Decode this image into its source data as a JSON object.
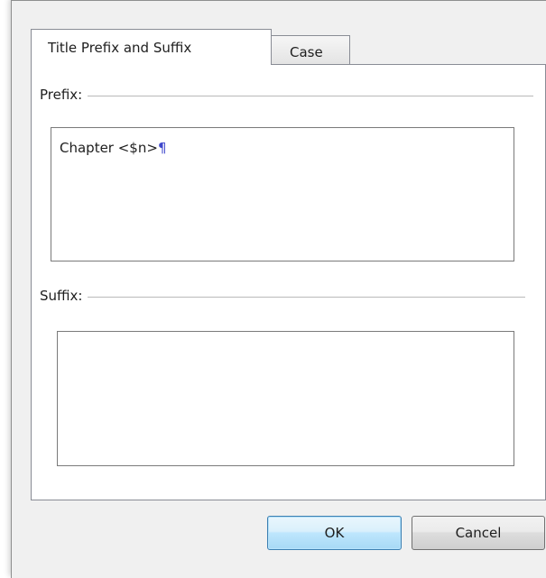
{
  "tabs": [
    {
      "label": "Title Prefix and Suffix",
      "active": true
    },
    {
      "label": "Case",
      "active": false
    }
  ],
  "prefix": {
    "label": "Prefix:",
    "value": "Chapter <$n>",
    "paragraph_mark": "¶"
  },
  "suffix": {
    "label": "Suffix:",
    "value": ""
  },
  "buttons": {
    "ok_label": "OK",
    "cancel_label": "Cancel"
  },
  "colors": {
    "paragraph_mark": "#3f48cc",
    "default_button_border": "#3c7fb1",
    "default_button_fill": "#bee6fd"
  }
}
